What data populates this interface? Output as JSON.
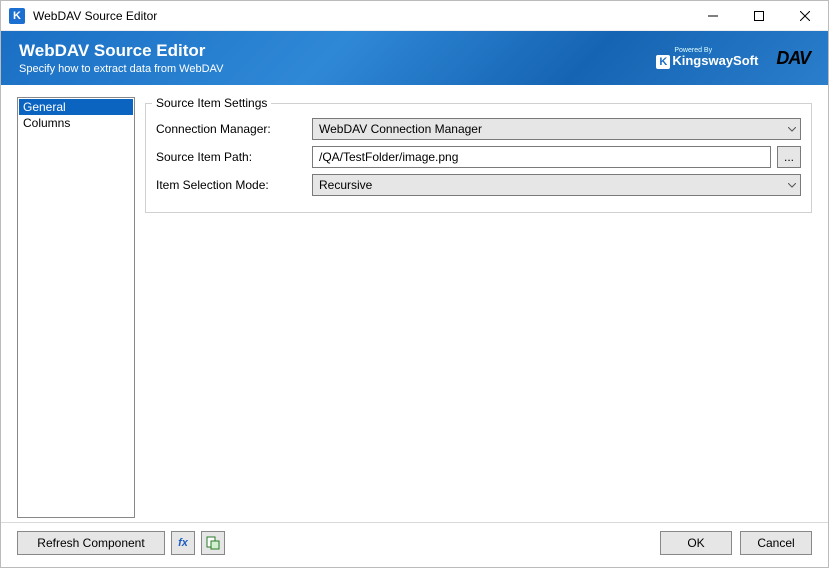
{
  "window": {
    "title": "WebDAV Source Editor"
  },
  "banner": {
    "title": "WebDAV Source Editor",
    "subtitle": "Specify how to extract data from WebDAV",
    "powered_by": "Powered By",
    "kingsway": "KingswaySoft",
    "dav": "DAV"
  },
  "sidebar": {
    "items": [
      {
        "label": "General",
        "selected": true
      },
      {
        "label": "Columns",
        "selected": false
      }
    ]
  },
  "settings": {
    "group_label": "Source Item Settings",
    "connection_manager": {
      "label": "Connection Manager:",
      "value": "WebDAV Connection Manager"
    },
    "source_item_path": {
      "label": "Source Item Path:",
      "value": "/QA/TestFolder/image.png",
      "browse_label": "..."
    },
    "item_selection_mode": {
      "label": "Item Selection Mode:",
      "value": "Recursive"
    }
  },
  "footer": {
    "refresh": "Refresh Component",
    "ok": "OK",
    "cancel": "Cancel"
  }
}
